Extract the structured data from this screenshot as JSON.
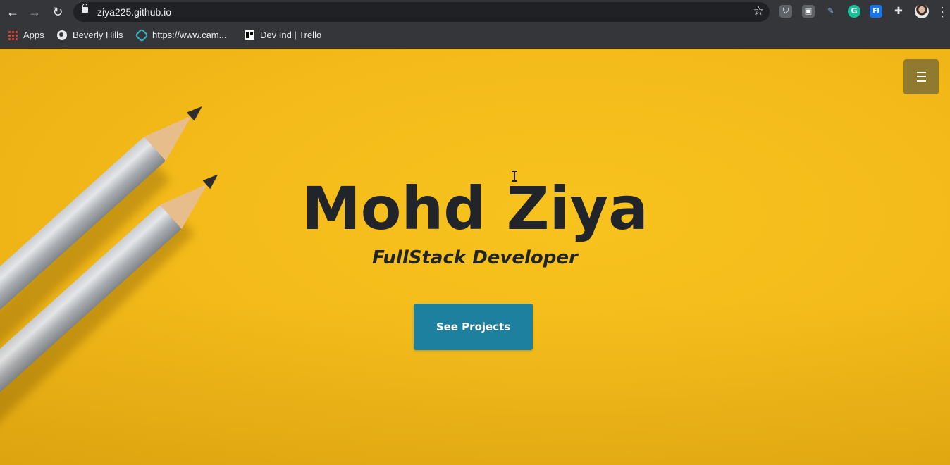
{
  "browser": {
    "back_icon": "←",
    "forward_icon": "→",
    "reload_icon": "↻",
    "url": "ziya225.github.io",
    "star_icon": "☆",
    "extensions": [
      {
        "name": "shield-extension",
        "glyph": "⛉",
        "color": "#5f6368"
      },
      {
        "name": "cast-extension",
        "glyph": "▣",
        "color": "#5f6368"
      },
      {
        "name": "pen-extension",
        "glyph": "✎",
        "color": "#5f6368"
      },
      {
        "name": "grammarly-extension",
        "glyph": "G",
        "color": "#15c39a"
      },
      {
        "name": "fi-extension",
        "glyph": "FI",
        "color": "#1a73e8"
      },
      {
        "name": "puzzle-extension",
        "glyph": "✚",
        "color": "#5f6368"
      }
    ],
    "menu_icon": "⋮"
  },
  "bookmarks": [
    {
      "label": "Apps"
    },
    {
      "label": "Beverly Hills"
    },
    {
      "label": "https://www.cam..."
    },
    {
      "label": "Dev Ind | Trello"
    }
  ],
  "hero": {
    "title": "Mohd Ziya",
    "subtitle": "FullStack Developer",
    "cta_label": "See Projects",
    "accent_color": "#1d809f",
    "background_color": "#f4bb1a"
  }
}
